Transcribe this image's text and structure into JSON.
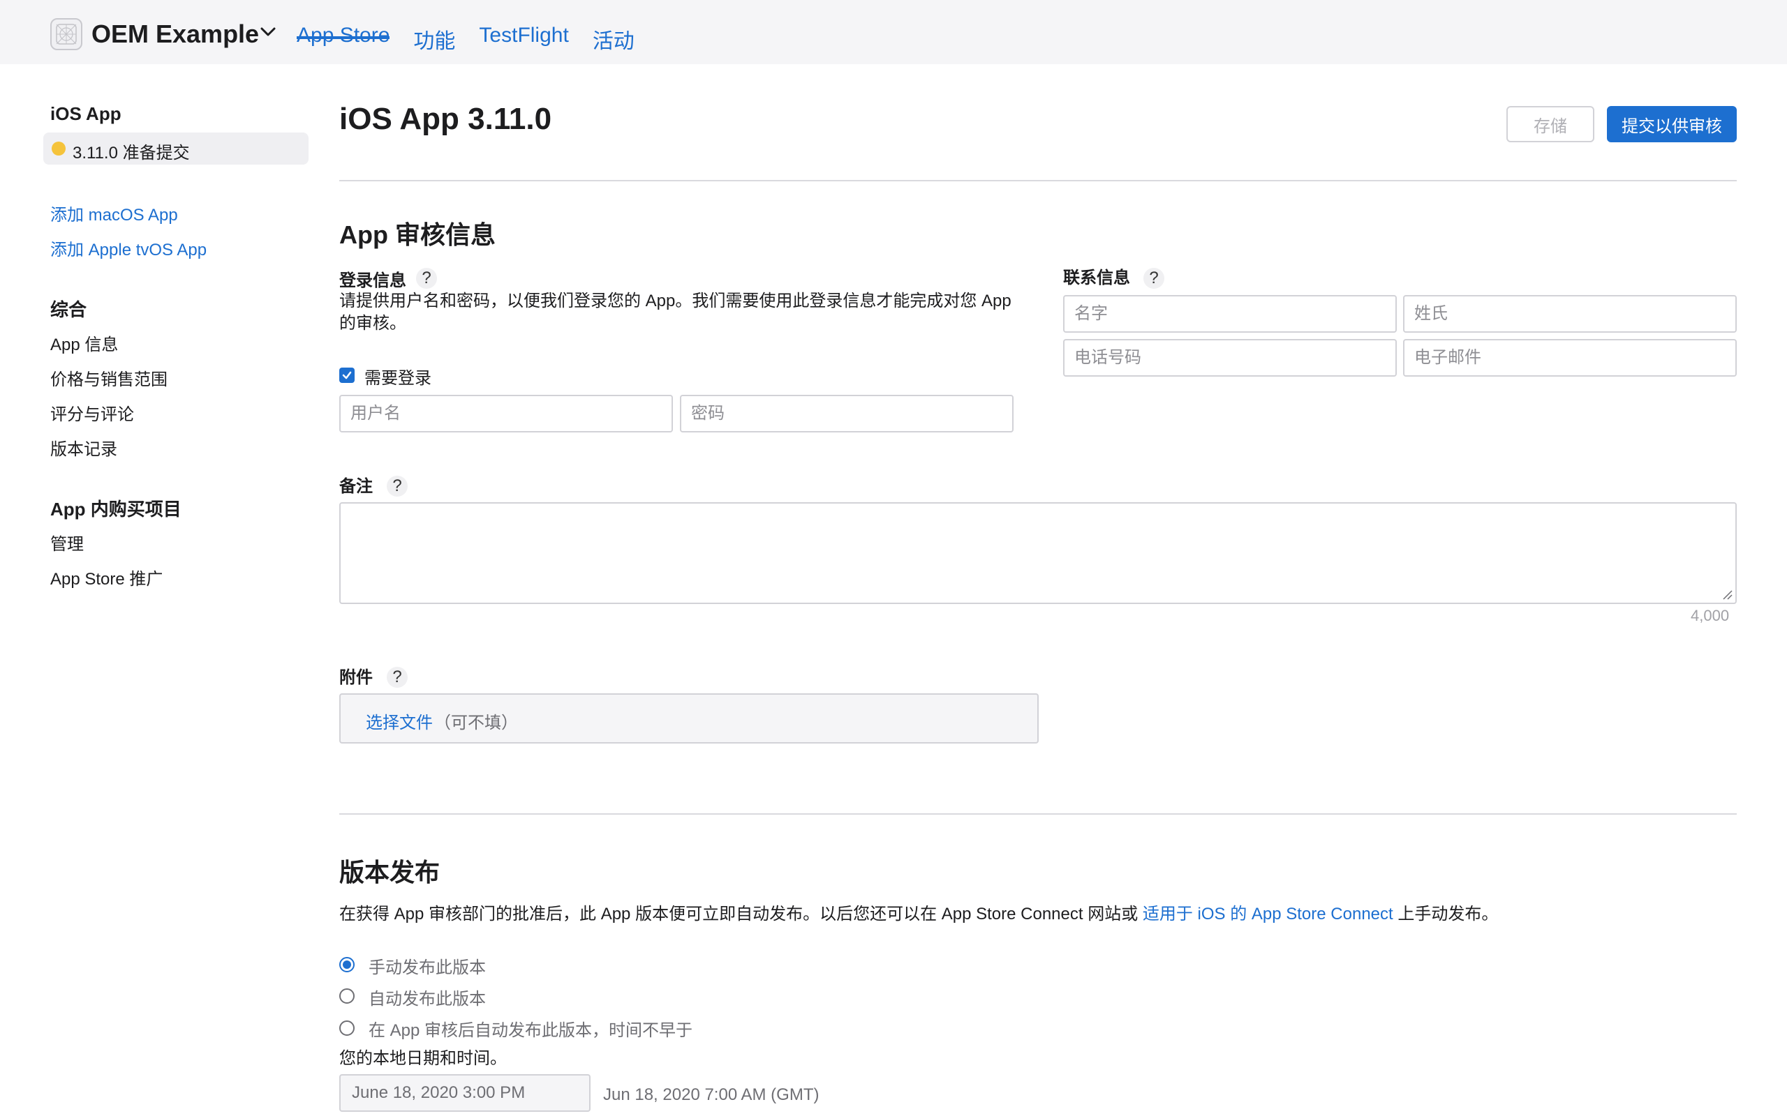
{
  "header": {
    "org_name": "OEM Example",
    "tabs": [
      {
        "label": "App Store",
        "active": true
      },
      {
        "label": "功能",
        "active": false
      },
      {
        "label": "TestFlight",
        "active": false
      },
      {
        "label": "活动",
        "active": false
      }
    ]
  },
  "sidebar": {
    "app_title": "iOS App",
    "version_item": {
      "label": "3.11.0 准备提交",
      "status_color": "#f5c33b"
    },
    "add_links": [
      "添加 macOS App",
      "添加 Apple tvOS App"
    ],
    "general": {
      "heading": "综合",
      "items": [
        "App 信息",
        "价格与销售范围",
        "评分与评论",
        "版本记录"
      ]
    },
    "iap": {
      "heading": "App 内购买项目",
      "items": [
        "管理",
        "App Store 推广"
      ]
    }
  },
  "main": {
    "title": "iOS App 3.11.0",
    "save_label": "存储",
    "submit_label": "提交以供审核",
    "review_section": {
      "title": "App 审核信息",
      "login": {
        "label": "登录信息",
        "description_line1": "请提供用户名和密码，以便我们登录您的 App。我们需要使用此登录信息才能完成对您 App",
        "description_line2": "的审核。",
        "checkbox_label": "需要登录",
        "checkbox_checked": true,
        "username_placeholder": "用户名",
        "password_placeholder": "密码"
      },
      "contact": {
        "label": "联系信息",
        "first_name_placeholder": "名字",
        "last_name_placeholder": "姓氏",
        "phone_placeholder": "电话号码",
        "email_placeholder": "电子邮件"
      },
      "notes": {
        "label": "备注",
        "max_chars": "4,000"
      },
      "attachment": {
        "label": "附件",
        "choose_file": "选择文件",
        "optional_hint": "（可不填）"
      }
    },
    "release_section": {
      "title": "版本发布",
      "description_prefix": "在获得 App 审核部门的批准后，此 App 版本便可立即自动发布。以后您还可以在 App Store Connect 网站或 ",
      "description_link": "适用于 iOS 的 App Store Connect",
      "description_suffix": " 上手动发布。",
      "options": [
        {
          "label": "手动发布此版本",
          "selected": true
        },
        {
          "label": "自动发布此版本",
          "selected": false
        },
        {
          "label": "在 App 审核后自动发布此版本，时间不早于",
          "selected": false
        }
      ],
      "local_time_label": "您的本地日期和时间。",
      "local_datetime": "June 18, 2020 3:00 PM",
      "gmt_datetime": "Jun 18, 2020 7:00 AM (GMT)"
    }
  },
  "colors": {
    "accent": "#1d6fd0",
    "status_pending": "#f5c33b"
  },
  "icons": {
    "app_icon": "app-placeholder-icon",
    "org_menu": "chevron-down-icon",
    "help": "question-mark-icon"
  }
}
